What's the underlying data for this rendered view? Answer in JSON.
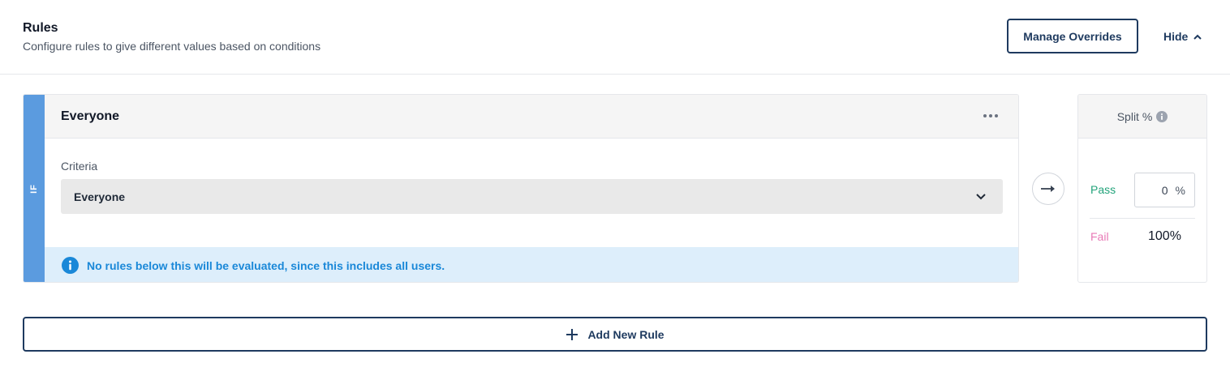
{
  "header": {
    "title": "Rules",
    "subtitle": "Configure rules to give different values based on conditions",
    "manage_overrides_label": "Manage Overrides",
    "hide_label": "Hide",
    "hide_icon": "chevron-up-icon"
  },
  "rule": {
    "if_label": "IF",
    "name": "Everyone",
    "more_icon": "more-horizontal-icon",
    "criteria_label": "Criteria",
    "criteria_value": "Everyone",
    "criteria_icon": "chevron-down-icon",
    "info_icon": "info-icon",
    "info_text": "No rules below this will be evaluated, since this includes all users."
  },
  "arrow_icon": "arrow-right-icon",
  "split": {
    "title": "Split %",
    "title_icon": "info-icon",
    "pass_label": "Pass",
    "pass_value": "0",
    "pass_suffix": "%",
    "fail_label": "Fail",
    "fail_value": "100%"
  },
  "add_rule": {
    "icon": "plus-icon",
    "label": "Add New Rule"
  },
  "colors": {
    "accent_navy": "#1e3a5f",
    "if_bar": "#5b9bdf",
    "info_blue": "#1a88d8",
    "info_bg": "#ddeefb",
    "pass_green": "#22a37a",
    "fail_pink": "#e879b6"
  }
}
